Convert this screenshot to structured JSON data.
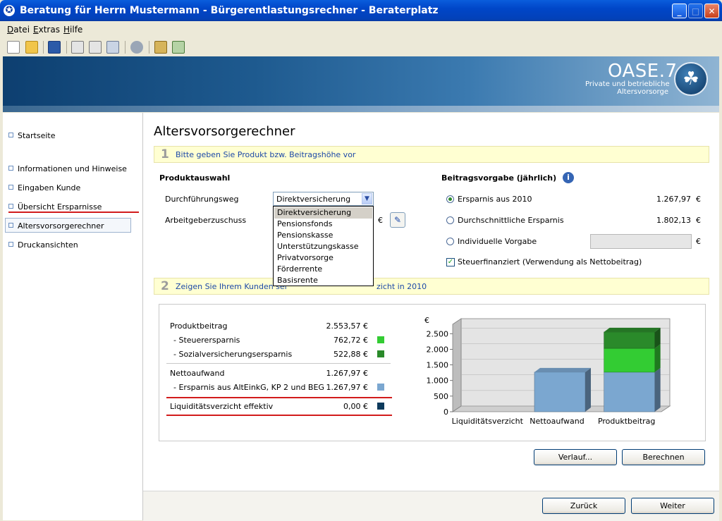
{
  "window": {
    "title": "Beratung für Herrn Mustermann - Bürgerentlastungsrechner - Beraterplatz"
  },
  "menu": [
    "Datei",
    "Extras",
    "Hilfe"
  ],
  "brand": {
    "logo": "OASE.7",
    "subtitle_line1": "Private und betriebliche",
    "subtitle_line2": "Altersvorsorge"
  },
  "sidebar": {
    "items": [
      {
        "label": "Startseite"
      },
      {
        "label": "Informationen und Hinweise"
      },
      {
        "label": "Eingaben Kunde"
      },
      {
        "label": "Übersicht Ersparnisse"
      },
      {
        "label": "Altersvorsorgerechner"
      },
      {
        "label": "Druckansichten"
      }
    ],
    "active": "Altersvorsorgerechner"
  },
  "page": {
    "title": "Altersvorsorgerechner"
  },
  "step1": {
    "number": "1",
    "text": "Bitte geben Sie Produkt bzw. Beitragshöhe vor"
  },
  "produktauswahl": {
    "heading": "Produktauswahl",
    "durchfuehrungsweg_label": "Durchführungsweg",
    "durchfuehrungsweg_value": "Direktversicherung",
    "options": [
      "Direktversicherung",
      "Pensionsfonds",
      "Pensionskasse",
      "Unterstützungskasse",
      "Privatvorsorge",
      "Förderrente",
      "Basisrente"
    ],
    "arbeitgeberzuschuss_label": "Arbeitgeberzuschuss",
    "currency": "€"
  },
  "beitragsvorgabe": {
    "heading": "Beitragsvorgabe (jährlich)",
    "options": [
      {
        "label": "Ersparnis aus 2010",
        "value": "1.267,97",
        "currency": "€",
        "selected": true
      },
      {
        "label": "Durchschnittliche Ersparnis",
        "value": "1.802,13",
        "currency": "€",
        "selected": false
      },
      {
        "label": "Individuelle Vorgabe",
        "value": "",
        "currency": "€",
        "selected": false
      }
    ],
    "steuerfinanziert_label": "Steuerfinanziert (Verwendung als Nettobeitrag)",
    "steuerfinanziert_checked": true
  },
  "step2": {
    "number": "2",
    "text_left": "Zeigen Sie Ihrem Kunden sei",
    "text_right": "zicht in 2010"
  },
  "result": {
    "rows": [
      {
        "label": "Produktbeitrag",
        "value": "2.553,57 €"
      },
      {
        "label": "- Steuerersparnis",
        "value": "762,72 €",
        "color": "#33cc33"
      },
      {
        "label": "- Sozialversicherungsersparnis",
        "value": "522,88 €",
        "color": "#2a8a2a"
      },
      {
        "label": "Nettoaufwand",
        "value": "1.267,97 €"
      },
      {
        "label": "- Ersparnis aus AltEinkG, KP 2 und BEG",
        "value": "1.267,97 €",
        "color": "#7ba7d0"
      },
      {
        "label": "Liquiditätsverzicht effektiv",
        "value": "0,00 €",
        "color": "#0d3a5c"
      }
    ]
  },
  "chart_data": {
    "type": "bar",
    "ylabel": "€",
    "categories": [
      "Liquiditätsverzicht",
      "Nettoaufwand",
      "Produktbeitrag"
    ],
    "series": [
      {
        "name": "",
        "color": "#7ba7d0",
        "values": [
          0,
          1267.97,
          1267.97
        ]
      },
      {
        "name": "",
        "color": "#33cc33",
        "values": [
          0,
          0,
          762.72
        ]
      },
      {
        "name": "",
        "color": "#2a8a2a",
        "values": [
          0,
          0,
          522.88
        ]
      }
    ],
    "yticks": [
      "0",
      "500",
      "1.000",
      "1.500",
      "2.000",
      "2.500"
    ],
    "ylim": [
      0,
      2800
    ],
    "stacked": true
  },
  "buttons": {
    "verlauf": "Verlauf...",
    "berechnen": "Berechnen",
    "zurueck": "Zurück",
    "weiter": "Weiter"
  }
}
